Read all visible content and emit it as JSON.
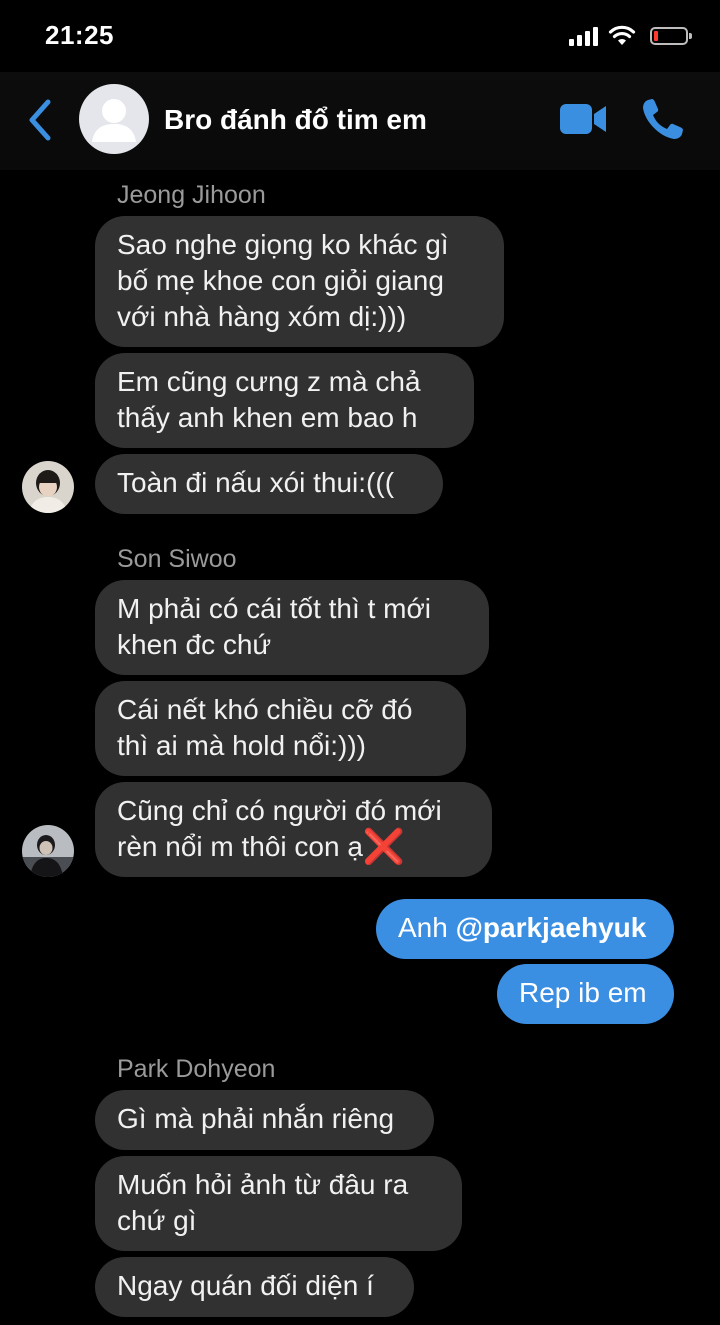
{
  "status_bar": {
    "time": "21:25"
  },
  "header": {
    "title": "Bro đánh đổ tim em"
  },
  "groups": [
    {
      "sender": "Jeong Jihoon",
      "messages": [
        [
          "Sao nghe giọng ko khác gì",
          "bố mẹ khoe con giỏi giang",
          "với nhà hàng xóm dị:)))"
        ],
        [
          "Em cũng cưng z mà chả",
          "thấy anh khen em bao h"
        ],
        [
          "Toàn đi nấu xói thui:((("
        ]
      ]
    },
    {
      "sender": "Son Siwoo",
      "messages": [
        [
          "M phải có cái tốt thì t mới",
          "khen đc chứ"
        ],
        [
          "Cái nết khó chiều cỡ đó",
          "thì ai mà hold nổi:)))"
        ],
        [
          "Cũng chỉ có người đó mới",
          "rèn nổi m thôi con ạ"
        ]
      ],
      "emoji": "❌"
    },
    {
      "sender": "Park Dohyeon",
      "messages": [
        [
          "Gì mà phải nhắn riêng"
        ],
        [
          "Muốn hỏi ảnh từ đâu ra",
          "chứ gì"
        ],
        [
          "Ngay quán đối diện í"
        ]
      ]
    }
  ],
  "outgoing": {
    "msg1_prefix": "Anh",
    "msg1_mention": "@parkjaehyuk",
    "msg2": "Rep ib em"
  },
  "colors": {
    "background": "#000000",
    "incoming_bubble": "#313131",
    "outgoing_bubble": "#3b8fe3",
    "accent_icon": "#3a8fe0",
    "sender_name": "#9a9a9a"
  }
}
